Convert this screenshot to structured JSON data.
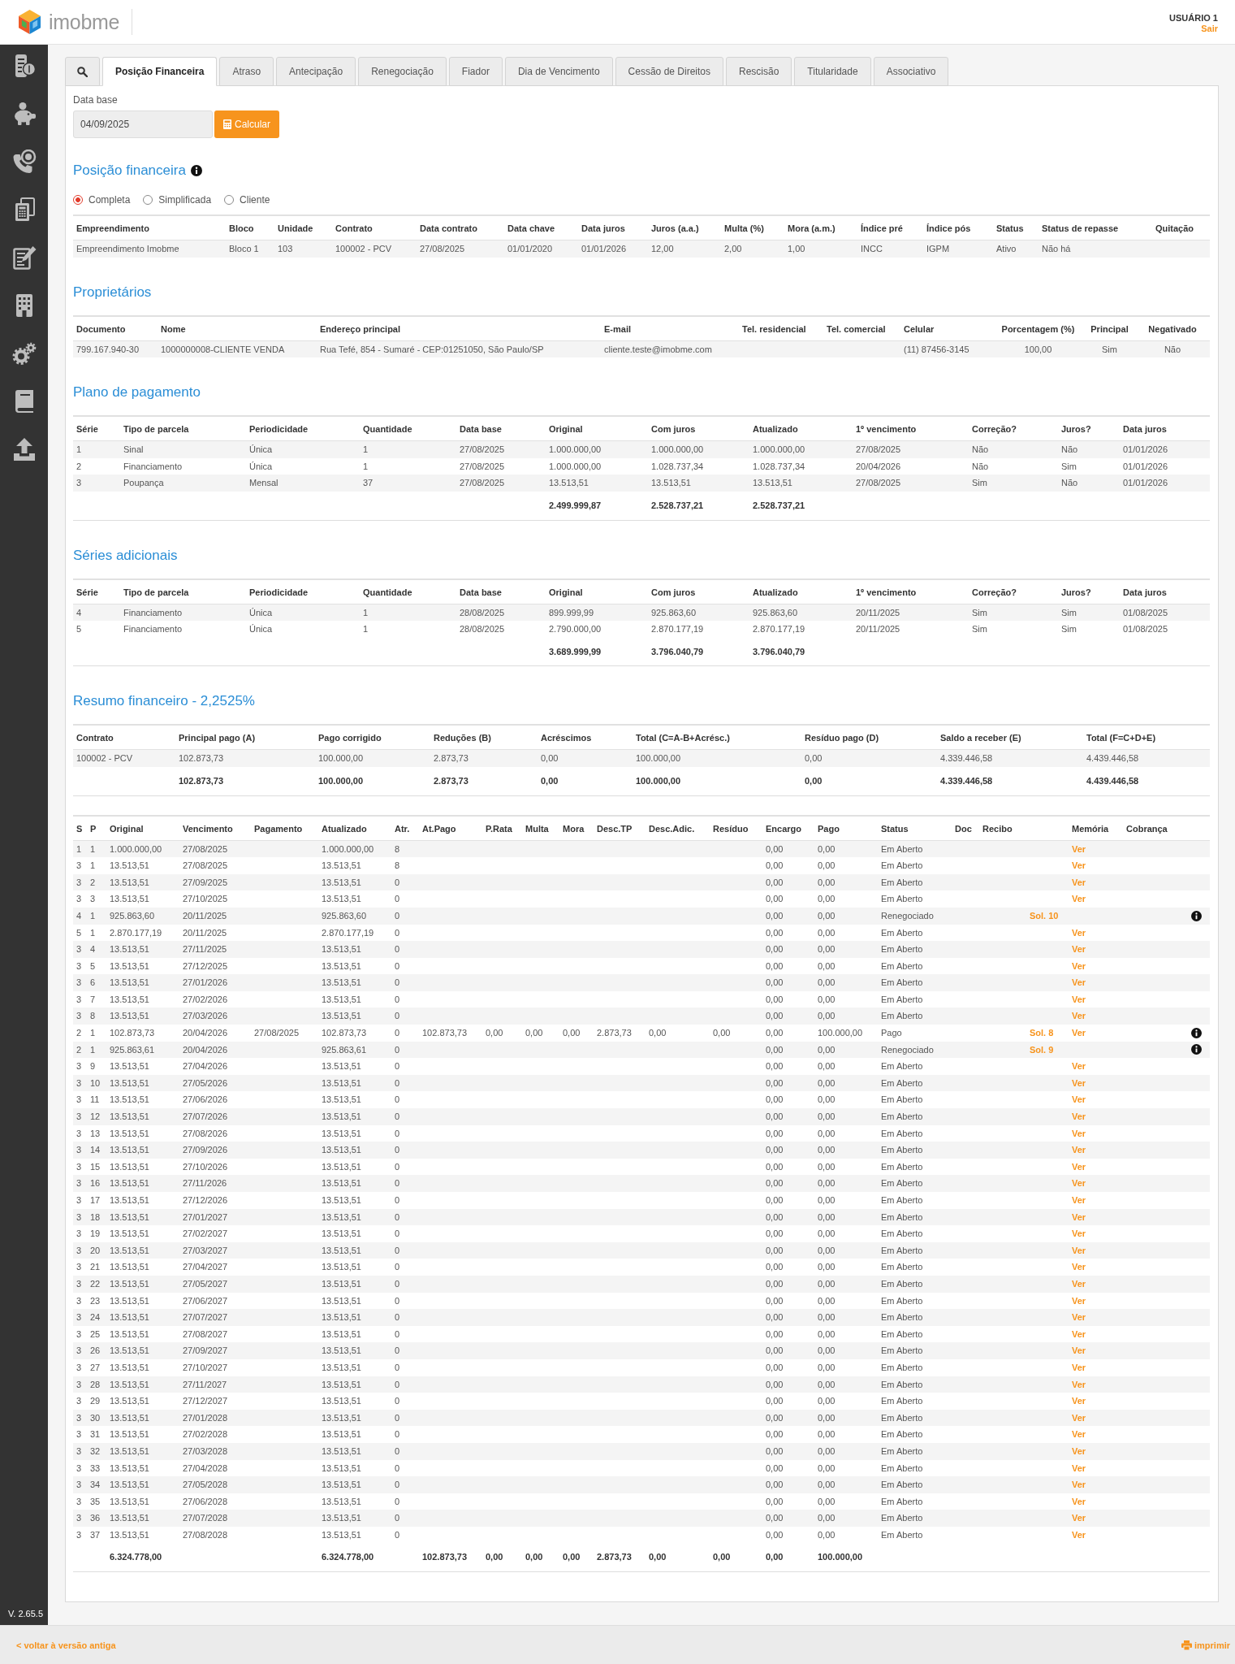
{
  "header": {
    "logo": "imobme",
    "user": "USUÁRIO 1",
    "logout": "Sair"
  },
  "sidebar": {
    "version": "V. 2.65.5"
  },
  "tabs": [
    {
      "label": "Posição Financeira",
      "selected": true
    },
    {
      "label": "Atraso",
      "selected": false
    },
    {
      "label": "Antecipação",
      "selected": false
    },
    {
      "label": "Renegociação",
      "selected": false
    },
    {
      "label": "Fiador",
      "selected": false
    },
    {
      "label": "Dia de Vencimento",
      "selected": false
    },
    {
      "label": "Cessão de Direitos",
      "selected": false
    },
    {
      "label": "Rescisão",
      "selected": false
    },
    {
      "label": "Titularidade",
      "selected": false
    },
    {
      "label": "Associativo",
      "selected": false
    }
  ],
  "form": {
    "label": "Data base",
    "value": "04/09/2025",
    "button": "Calcular"
  },
  "position": {
    "title": "Posição financeira",
    "view_options": [
      {
        "label": "Completa",
        "selected": true
      },
      {
        "label": "Simplificada",
        "selected": false
      },
      {
        "label": "Cliente",
        "selected": false
      }
    ],
    "table": {
      "columns": [
        "Empreendimento",
        "Bloco",
        "Unidade",
        "Contrato",
        "Data contrato",
        "Data chave",
        "Data juros",
        "Juros (a.a.)",
        "Multa (%)",
        "Mora (a.m.)",
        "Índice pré",
        "Índice pós",
        "Status",
        "Status de repasse",
        "Quitação"
      ],
      "rows": [
        {
          "empreendimento": "Empreendimento Imobme",
          "bloco": "Bloco 1",
          "unidade": "103",
          "contrato": "100002 - PCV",
          "data_contrato": "27/08/2025",
          "data_chave": "01/01/2020",
          "data_juros": "01/01/2026",
          "juros_aa": "12,00",
          "multa": "2,00",
          "mora": "1,00",
          "indice_pre": "INCC",
          "indice_pos": "IGPM",
          "status": "Ativo",
          "status_repasse": "Não há"
        }
      ]
    }
  },
  "owners": {
    "title": "Proprietários",
    "table": {
      "columns": [
        "Documento",
        "Nome",
        "Endereço principal",
        "E-mail",
        "Tel. residencial",
        "Tel. comercial",
        "Celular",
        "Porcentagem (%)",
        "Principal",
        "Negativado"
      ],
      "rows": [
        {
          "documento": "799.167.940-30",
          "nome": "1000000008-CLIENTE VENDA",
          "endereco": "Rua Tefé, 854 - Sumaré - CEP:01251050, São Paulo/SP",
          "email": "cliente.teste@imobme.com",
          "celular": "(11) 87456-3145",
          "porcentagem": "100,00",
          "principal": "Sim",
          "negativado": "Não"
        }
      ]
    }
  },
  "payment_plan": {
    "title": "Plano de pagamento",
    "table": {
      "columns": [
        "Série",
        "Tipo de parcela",
        "Periodicidade",
        "Quantidade",
        "Data base",
        "Original",
        "Com juros",
        "Atualizado",
        "1º vencimento",
        "Correção?",
        "Juros?",
        "Data juros"
      ],
      "rows": [
        {
          "serie": "1",
          "tipo_parcela": "Sinal",
          "periodicidade": "Única",
          "quantidade": "1",
          "data_base": "27/08/2025",
          "original": "1.000.000,00",
          "com_juros": "1.000.000,00",
          "atualizado": "1.000.000,00",
          "primeiro_vencimento": "27/08/2025",
          "correcao": "Não",
          "juros": "Não",
          "data_juros": "01/01/2026"
        },
        {
          "serie": "2",
          "tipo_parcela": "Financiamento",
          "periodicidade": "Única",
          "quantidade": "1",
          "data_base": "27/08/2025",
          "original": "1.000.000,00",
          "com_juros": "1.028.737,34",
          "atualizado": "1.028.737,34",
          "primeiro_vencimento": "20/04/2026",
          "correcao": "Não",
          "juros": "Sim",
          "data_juros": "01/01/2026"
        },
        {
          "serie": "3",
          "tipo_parcela": "Poupança",
          "periodicidade": "Mensal",
          "quantidade": "37",
          "data_base": "27/08/2025",
          "original": "13.513,51",
          "com_juros": "13.513,51",
          "atualizado": "13.513,51",
          "primeiro_vencimento": "27/08/2025",
          "correcao": "Sim",
          "juros": "Não",
          "data_juros": "01/01/2026"
        }
      ],
      "totals": {
        "original": "2.499.999,87",
        "com_juros": "2.528.737,21",
        "atualizado": "2.528.737,21"
      }
    }
  },
  "additional_series": {
    "title": "Séries adicionais",
    "table": {
      "columns": [
        "Série",
        "Tipo de parcela",
        "Periodicidade",
        "Quantidade",
        "Data base",
        "Original",
        "Com juros",
        "Atualizado",
        "1º vencimento",
        "Correção?",
        "Juros?",
        "Data juros"
      ],
      "rows": [
        {
          "serie": "4",
          "tipo_parcela": "Financiamento",
          "periodicidade": "Única",
          "quantidade": "1",
          "data_base": "28/08/2025",
          "original": "899.999,99",
          "com_juros": "925.863,60",
          "atualizado": "925.863,60",
          "primeiro_vencimento": "20/11/2025",
          "correcao": "Sim",
          "juros": "Sim",
          "data_juros": "01/08/2025"
        },
        {
          "serie": "5",
          "tipo_parcela": "Financiamento",
          "periodicidade": "Única",
          "quantidade": "1",
          "data_base": "28/08/2025",
          "original": "2.790.000,00",
          "com_juros": "2.870.177,19",
          "atualizado": "2.870.177,19",
          "primeiro_vencimento": "20/11/2025",
          "correcao": "Sim",
          "juros": "Sim",
          "data_juros": "01/08/2025"
        }
      ],
      "totals": {
        "original": "3.689.999,99",
        "com_juros": "3.796.040,79",
        "atualizado": "3.796.040,79"
      }
    }
  },
  "financial_summary": {
    "title": "Resumo financeiro - 2,2525%",
    "table": {
      "columns": [
        "Contrato",
        "Principal pago (A)",
        "Pago corrigido",
        "Reduções (B)",
        "Acréscimos",
        "Total (C=A-B+Acrésc.)",
        "Resíduo pago (D)",
        "Saldo a receber (E)",
        "Total (F=C+D+E)"
      ],
      "rows": [
        {
          "contrato": "100002 - PCV",
          "principal_pago": "102.873,73",
          "pago_corrigido": "100.000,00",
          "reducoes": "2.873,73",
          "acrescimos": "0,00",
          "total_c": "100.000,00",
          "residuo_pago": "0,00",
          "saldo_receber": "4.339.446,58",
          "total_f": "4.439.446,58"
        }
      ],
      "totals": {
        "principal_pago": "102.873,73",
        "pago_corrigido": "100.000,00",
        "reducoes": "2.873,73",
        "acrescimos": "0,00",
        "total_c": "100.000,00",
        "residuo_pago": "0,00",
        "saldo_receber": "4.339.446,58",
        "total_f": "4.439.446,58"
      }
    }
  },
  "installments": {
    "columns": [
      "S",
      "P",
      "Original",
      "Vencimento",
      "Pagamento",
      "Atualizado",
      "Atr.",
      "At.Pago",
      "P.Rata",
      "Multa",
      "Mora",
      "Desc.TP",
      "Desc.Adic.",
      "Resíduo",
      "Encargo",
      "Pago",
      "Status",
      "Doc",
      "Recibo",
      "Memória",
      "Cobrança"
    ],
    "rows": [
      {
        "s": "1",
        "p": "1",
        "original": "1.000.000,00",
        "vencimento": "27/08/2025",
        "atualizado": "1.000.000,00",
        "atr": "8",
        "encargo": "0,00",
        "pago": "0,00",
        "status": "Em Aberto",
        "memoria": "Ver",
        "info": false
      },
      {
        "s": "3",
        "p": "1",
        "original": "13.513,51",
        "vencimento": "27/08/2025",
        "atualizado": "13.513,51",
        "atr": "8",
        "encargo": "0,00",
        "pago": "0,00",
        "status": "Em Aberto",
        "memoria": "Ver",
        "info": false
      },
      {
        "s": "3",
        "p": "2",
        "original": "13.513,51",
        "vencimento": "27/09/2025",
        "atualizado": "13.513,51",
        "atr": "0",
        "encargo": "0,00",
        "pago": "0,00",
        "status": "Em Aberto",
        "memoria": "Ver",
        "info": false
      },
      {
        "s": "3",
        "p": "3",
        "original": "13.513,51",
        "vencimento": "27/10/2025",
        "atualizado": "13.513,51",
        "atr": "0",
        "encargo": "0,00",
        "pago": "0,00",
        "status": "Em Aberto",
        "memoria": "Ver",
        "info": false
      },
      {
        "s": "4",
        "p": "1",
        "original": "925.863,60",
        "vencimento": "20/11/2025",
        "atualizado": "925.863,60",
        "atr": "0",
        "encargo": "0,00",
        "pago": "0,00",
        "status": "Renegociado",
        "column_20": "Sol. 10",
        "info": true
      },
      {
        "s": "5",
        "p": "1",
        "original": "2.870.177,19",
        "vencimento": "20/11/2025",
        "atualizado": "2.870.177,19",
        "atr": "0",
        "encargo": "0,00",
        "pago": "0,00",
        "status": "Em Aberto",
        "memoria": "Ver",
        "info": false
      },
      {
        "s": "3",
        "p": "4",
        "original": "13.513,51",
        "vencimento": "27/11/2025",
        "atualizado": "13.513,51",
        "atr": "0",
        "encargo": "0,00",
        "pago": "0,00",
        "status": "Em Aberto",
        "memoria": "Ver",
        "info": false
      },
      {
        "s": "3",
        "p": "5",
        "original": "13.513,51",
        "vencimento": "27/12/2025",
        "atualizado": "13.513,51",
        "atr": "0",
        "encargo": "0,00",
        "pago": "0,00",
        "status": "Em Aberto",
        "memoria": "Ver",
        "info": false
      },
      {
        "s": "3",
        "p": "6",
        "original": "13.513,51",
        "vencimento": "27/01/2026",
        "atualizado": "13.513,51",
        "atr": "0",
        "encargo": "0,00",
        "pago": "0,00",
        "status": "Em Aberto",
        "memoria": "Ver",
        "info": false
      },
      {
        "s": "3",
        "p": "7",
        "original": "13.513,51",
        "vencimento": "27/02/2026",
        "atualizado": "13.513,51",
        "atr": "0",
        "encargo": "0,00",
        "pago": "0,00",
        "status": "Em Aberto",
        "memoria": "Ver",
        "info": false
      },
      {
        "s": "3",
        "p": "8",
        "original": "13.513,51",
        "vencimento": "27/03/2026",
        "atualizado": "13.513,51",
        "atr": "0",
        "encargo": "0,00",
        "pago": "0,00",
        "status": "Em Aberto",
        "memoria": "Ver",
        "info": false
      },
      {
        "s": "2",
        "p": "1",
        "original": "102.873,73",
        "vencimento": "20/04/2026",
        "pagamento": "27/08/2025",
        "atualizado": "102.873,73",
        "atr": "0",
        "at_pago": "102.873,73",
        "p_rata": "0,00",
        "multa": "0,00",
        "mora": "0,00",
        "desc_tp": "2.873,73",
        "desc_adic": "0,00",
        "residuo": "0,00",
        "encargo": "0,00",
        "pago": "100.000,00",
        "status": "Pago",
        "column_20": "Sol. 8",
        "memoria": "Ver",
        "info": true
      },
      {
        "s": "2",
        "p": "1",
        "original": "925.863,61",
        "vencimento": "20/04/2026",
        "atualizado": "925.863,61",
        "atr": "0",
        "encargo": "0,00",
        "pago": "0,00",
        "status": "Renegociado",
        "column_20": "Sol. 9",
        "info": true
      },
      {
        "s": "3",
        "p": "9",
        "original": "13.513,51",
        "vencimento": "27/04/2026",
        "atualizado": "13.513,51",
        "atr": "0",
        "encargo": "0,00",
        "pago": "0,00",
        "status": "Em Aberto",
        "memoria": "Ver",
        "info": false
      },
      {
        "s": "3",
        "p": "10",
        "original": "13.513,51",
        "vencimento": "27/05/2026",
        "atualizado": "13.513,51",
        "atr": "0",
        "encargo": "0,00",
        "pago": "0,00",
        "status": "Em Aberto",
        "memoria": "Ver",
        "info": false
      },
      {
        "s": "3",
        "p": "11",
        "original": "13.513,51",
        "vencimento": "27/06/2026",
        "atualizado": "13.513,51",
        "atr": "0",
        "encargo": "0,00",
        "pago": "0,00",
        "status": "Em Aberto",
        "memoria": "Ver",
        "info": false
      },
      {
        "s": "3",
        "p": "12",
        "original": "13.513,51",
        "vencimento": "27/07/2026",
        "atualizado": "13.513,51",
        "atr": "0",
        "encargo": "0,00",
        "pago": "0,00",
        "status": "Em Aberto",
        "memoria": "Ver",
        "info": false
      },
      {
        "s": "3",
        "p": "13",
        "original": "13.513,51",
        "vencimento": "27/08/2026",
        "atualizado": "13.513,51",
        "atr": "0",
        "encargo": "0,00",
        "pago": "0,00",
        "status": "Em Aberto",
        "memoria": "Ver",
        "info": false
      },
      {
        "s": "3",
        "p": "14",
        "original": "13.513,51",
        "vencimento": "27/09/2026",
        "atualizado": "13.513,51",
        "atr": "0",
        "encargo": "0,00",
        "pago": "0,00",
        "status": "Em Aberto",
        "memoria": "Ver",
        "info": false
      },
      {
        "s": "3",
        "p": "15",
        "original": "13.513,51",
        "vencimento": "27/10/2026",
        "atualizado": "13.513,51",
        "atr": "0",
        "encargo": "0,00",
        "pago": "0,00",
        "status": "Em Aberto",
        "memoria": "Ver",
        "info": false
      },
      {
        "s": "3",
        "p": "16",
        "original": "13.513,51",
        "vencimento": "27/11/2026",
        "atualizado": "13.513,51",
        "atr": "0",
        "encargo": "0,00",
        "pago": "0,00",
        "status": "Em Aberto",
        "memoria": "Ver",
        "info": false
      },
      {
        "s": "3",
        "p": "17",
        "original": "13.513,51",
        "vencimento": "27/12/2026",
        "atualizado": "13.513,51",
        "atr": "0",
        "encargo": "0,00",
        "pago": "0,00",
        "status": "Em Aberto",
        "memoria": "Ver",
        "info": false
      },
      {
        "s": "3",
        "p": "18",
        "original": "13.513,51",
        "vencimento": "27/01/2027",
        "atualizado": "13.513,51",
        "atr": "0",
        "encargo": "0,00",
        "pago": "0,00",
        "status": "Em Aberto",
        "memoria": "Ver",
        "info": false
      },
      {
        "s": "3",
        "p": "19",
        "original": "13.513,51",
        "vencimento": "27/02/2027",
        "atualizado": "13.513,51",
        "atr": "0",
        "encargo": "0,00",
        "pago": "0,00",
        "status": "Em Aberto",
        "memoria": "Ver",
        "info": false
      },
      {
        "s": "3",
        "p": "20",
        "original": "13.513,51",
        "vencimento": "27/03/2027",
        "atualizado": "13.513,51",
        "atr": "0",
        "encargo": "0,00",
        "pago": "0,00",
        "status": "Em Aberto",
        "memoria": "Ver",
        "info": false
      },
      {
        "s": "3",
        "p": "21",
        "original": "13.513,51",
        "vencimento": "27/04/2027",
        "atualizado": "13.513,51",
        "atr": "0",
        "encargo": "0,00",
        "pago": "0,00",
        "status": "Em Aberto",
        "memoria": "Ver",
        "info": false
      },
      {
        "s": "3",
        "p": "22",
        "original": "13.513,51",
        "vencimento": "27/05/2027",
        "atualizado": "13.513,51",
        "atr": "0",
        "encargo": "0,00",
        "pago": "0,00",
        "status": "Em Aberto",
        "memoria": "Ver",
        "info": false
      },
      {
        "s": "3",
        "p": "23",
        "original": "13.513,51",
        "vencimento": "27/06/2027",
        "atualizado": "13.513,51",
        "atr": "0",
        "encargo": "0,00",
        "pago": "0,00",
        "status": "Em Aberto",
        "memoria": "Ver",
        "info": false
      },
      {
        "s": "3",
        "p": "24",
        "original": "13.513,51",
        "vencimento": "27/07/2027",
        "atualizado": "13.513,51",
        "atr": "0",
        "encargo": "0,00",
        "pago": "0,00",
        "status": "Em Aberto",
        "memoria": "Ver",
        "info": false
      },
      {
        "s": "3",
        "p": "25",
        "original": "13.513,51",
        "vencimento": "27/08/2027",
        "atualizado": "13.513,51",
        "atr": "0",
        "encargo": "0,00",
        "pago": "0,00",
        "status": "Em Aberto",
        "memoria": "Ver",
        "info": false
      },
      {
        "s": "3",
        "p": "26",
        "original": "13.513,51",
        "vencimento": "27/09/2027",
        "atualizado": "13.513,51",
        "atr": "0",
        "encargo": "0,00",
        "pago": "0,00",
        "status": "Em Aberto",
        "memoria": "Ver",
        "info": false
      },
      {
        "s": "3",
        "p": "27",
        "original": "13.513,51",
        "vencimento": "27/10/2027",
        "atualizado": "13.513,51",
        "atr": "0",
        "encargo": "0,00",
        "pago": "0,00",
        "status": "Em Aberto",
        "memoria": "Ver",
        "info": false
      },
      {
        "s": "3",
        "p": "28",
        "original": "13.513,51",
        "vencimento": "27/11/2027",
        "atualizado": "13.513,51",
        "atr": "0",
        "encargo": "0,00",
        "pago": "0,00",
        "status": "Em Aberto",
        "memoria": "Ver",
        "info": false
      },
      {
        "s": "3",
        "p": "29",
        "original": "13.513,51",
        "vencimento": "27/12/2027",
        "atualizado": "13.513,51",
        "atr": "0",
        "encargo": "0,00",
        "pago": "0,00",
        "status": "Em Aberto",
        "memoria": "Ver",
        "info": false
      },
      {
        "s": "3",
        "p": "30",
        "original": "13.513,51",
        "vencimento": "27/01/2028",
        "atualizado": "13.513,51",
        "atr": "0",
        "encargo": "0,00",
        "pago": "0,00",
        "status": "Em Aberto",
        "memoria": "Ver",
        "info": false
      },
      {
        "s": "3",
        "p": "31",
        "original": "13.513,51",
        "vencimento": "27/02/2028",
        "atualizado": "13.513,51",
        "atr": "0",
        "encargo": "0,00",
        "pago": "0,00",
        "status": "Em Aberto",
        "memoria": "Ver",
        "info": false
      },
      {
        "s": "3",
        "p": "32",
        "original": "13.513,51",
        "vencimento": "27/03/2028",
        "atualizado": "13.513,51",
        "atr": "0",
        "encargo": "0,00",
        "pago": "0,00",
        "status": "Em Aberto",
        "memoria": "Ver",
        "info": false
      },
      {
        "s": "3",
        "p": "33",
        "original": "13.513,51",
        "vencimento": "27/04/2028",
        "atualizado": "13.513,51",
        "atr": "0",
        "encargo": "0,00",
        "pago": "0,00",
        "status": "Em Aberto",
        "memoria": "Ver",
        "info": false
      },
      {
        "s": "3",
        "p": "34",
        "original": "13.513,51",
        "vencimento": "27/05/2028",
        "atualizado": "13.513,51",
        "atr": "0",
        "encargo": "0,00",
        "pago": "0,00",
        "status": "Em Aberto",
        "memoria": "Ver",
        "info": false
      },
      {
        "s": "3",
        "p": "35",
        "original": "13.513,51",
        "vencimento": "27/06/2028",
        "atualizado": "13.513,51",
        "atr": "0",
        "encargo": "0,00",
        "pago": "0,00",
        "status": "Em Aberto",
        "memoria": "Ver",
        "info": false
      },
      {
        "s": "3",
        "p": "36",
        "original": "13.513,51",
        "vencimento": "27/07/2028",
        "atualizado": "13.513,51",
        "atr": "0",
        "encargo": "0,00",
        "pago": "0,00",
        "status": "Em Aberto",
        "memoria": "Ver",
        "info": false
      },
      {
        "s": "3",
        "p": "37",
        "original": "13.513,51",
        "vencimento": "27/08/2028",
        "atualizado": "13.513,51",
        "atr": "0",
        "encargo": "0,00",
        "pago": "0,00",
        "status": "Em Aberto",
        "memoria": "Ver",
        "info": false
      }
    ],
    "totals": {
      "original": "6.324.778,00",
      "atualizado": "6.324.778,00",
      "at_pago": "102.873,73",
      "p_rata": "0,00",
      "multa": "0,00",
      "mora": "0,00",
      "desc_tp": "2.873,73",
      "desc_adic": "0,00",
      "residuo": "0,00",
      "encargo": "0,00",
      "pago": "100.000,00"
    }
  },
  "footer": {
    "back_link": "< voltar à versão antiga",
    "print": "imprimir"
  }
}
